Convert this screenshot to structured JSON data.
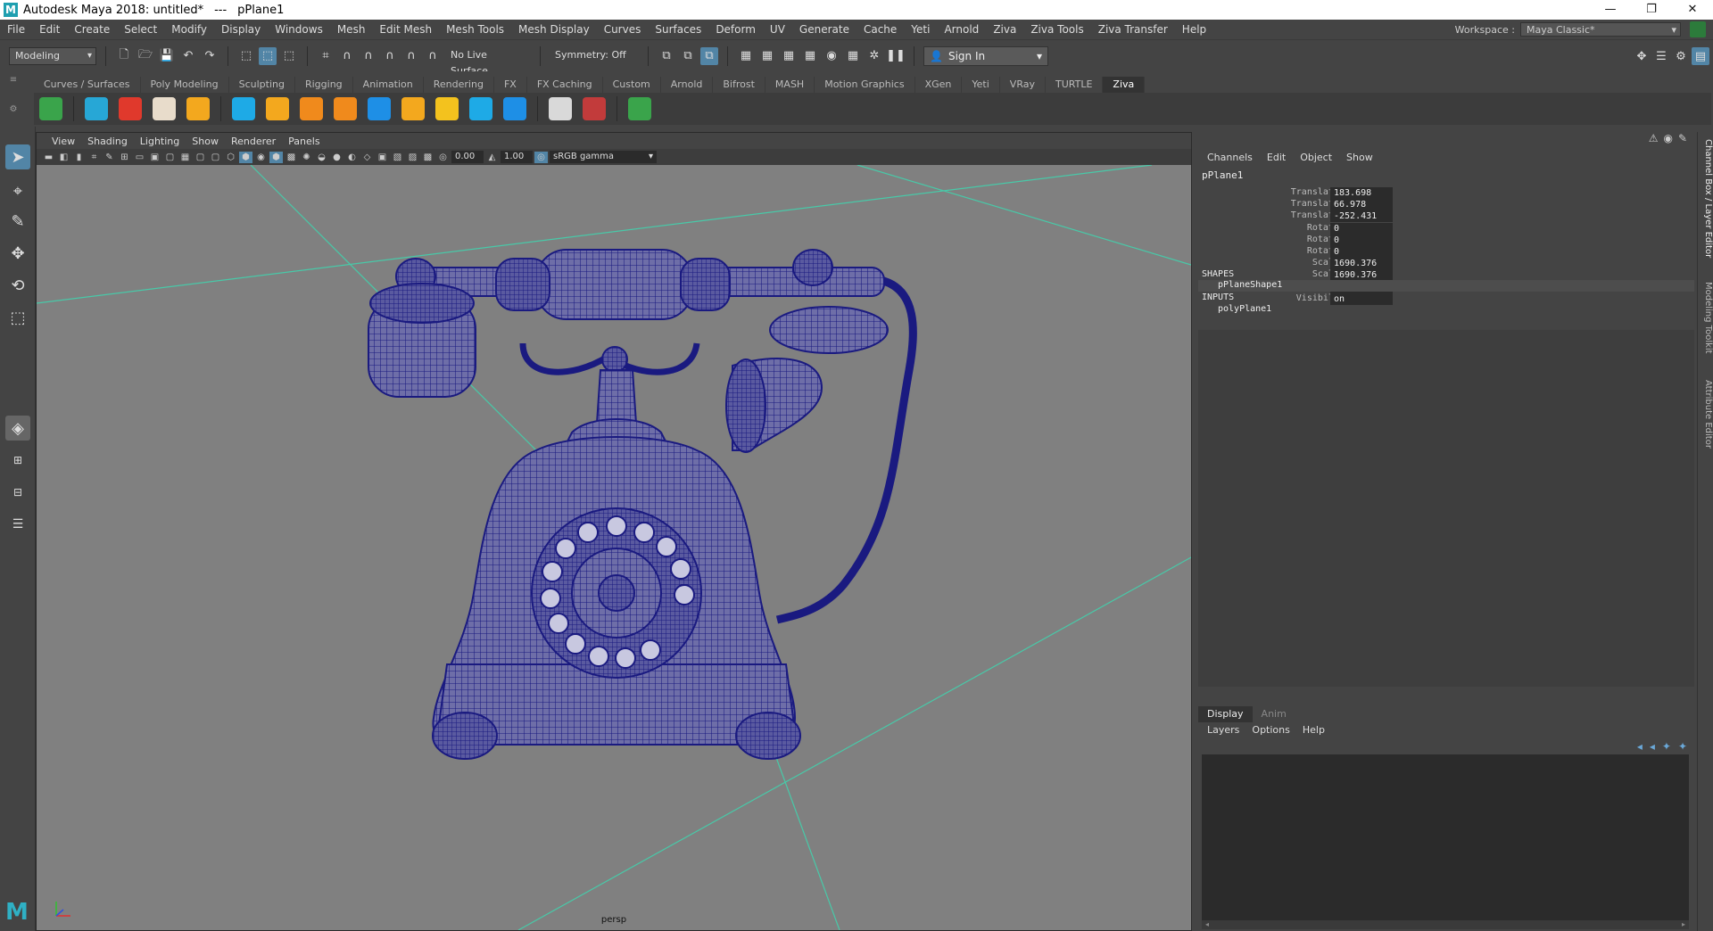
{
  "window": {
    "title": "Autodesk Maya 2018: untitled*",
    "separator": "---",
    "selection": "pPlane1",
    "controls": [
      "—",
      "❐",
      "✕"
    ]
  },
  "menus": [
    "File",
    "Edit",
    "Create",
    "Select",
    "Modify",
    "Display",
    "Windows",
    "Mesh",
    "Edit Mesh",
    "Mesh Tools",
    "Mesh Display",
    "Curves",
    "Surfaces",
    "Deform",
    "UV",
    "Generate",
    "Cache",
    "Yeti",
    "Arnold",
    "Ziva",
    "Ziva Tools",
    "Ziva Transfer",
    "Help"
  ],
  "workspace": {
    "label": "Workspace :",
    "value": "Maya Classic*"
  },
  "statusline": {
    "mode": "Modeling",
    "live_surface": "No Live Surface",
    "symmetry": "Symmetry: Off",
    "signin": "Sign In"
  },
  "shelf_tabs": [
    "Curves / Surfaces",
    "Poly Modeling",
    "Sculpting",
    "Rigging",
    "Animation",
    "Rendering",
    "FX",
    "FX Caching",
    "Custom",
    "Arnold",
    "Bifrost",
    "MASH",
    "Motion Graphics",
    "XGen",
    "Yeti",
    "VRay",
    "TURTLE",
    "Ziva"
  ],
  "shelf_active": "Ziva",
  "shelf_icons": [
    {
      "name": "ziva-load-icon",
      "color": "#3aa44b"
    },
    {
      "name": "ziva-tissue-icon",
      "color": "#27a7d6"
    },
    {
      "name": "ziva-muscle-icon",
      "color": "#e0392c"
    },
    {
      "name": "ziva-bone-icon",
      "color": "#e8dccb"
    },
    {
      "name": "ziva-star-icon",
      "color": "#f3a81e"
    },
    {
      "name": "ziva-attachment-icon",
      "color": "#1eaae6"
    },
    {
      "name": "ziva-cloth-icon",
      "color": "#f3a81e"
    },
    {
      "name": "ziva-fiber-icon",
      "color": "#f08a1c"
    },
    {
      "name": "ziva-material-icon",
      "color": "#f08a1c"
    },
    {
      "name": "ziva-line-of-action-icon",
      "color": "#1e8fe6"
    },
    {
      "name": "ziva-rivet-icon",
      "color": "#f3a81e"
    },
    {
      "name": "ziva-curve-icon",
      "color": "#f3c21e"
    },
    {
      "name": "ziva-paint-icon",
      "color": "#1eaae6"
    },
    {
      "name": "ziva-cache-icon",
      "color": "#1e8fe6"
    },
    {
      "name": "ziva-settings-icon",
      "color": "#d9d9d9"
    },
    {
      "name": "ziva-delete-icon",
      "color": "#c23b3b"
    },
    {
      "name": "ziva-play-icon",
      "color": "#3aa44b"
    }
  ],
  "viewport": {
    "menus": [
      "View",
      "Shading",
      "Lighting",
      "Show",
      "Renderer",
      "Panels"
    ],
    "exposure": "0.00",
    "gamma": "1.00",
    "colorspace": "sRGB gamma",
    "camera": "persp"
  },
  "channel_box": {
    "menus": [
      "Channels",
      "Edit",
      "Object",
      "Show"
    ],
    "object": "pPlane1",
    "attributes": [
      {
        "label": "Translate X",
        "value": "183.698"
      },
      {
        "label": "Translate Y",
        "value": "66.978"
      },
      {
        "label": "Translate Z",
        "value": "-252.431"
      },
      {
        "label": "Rotate X",
        "value": "0"
      },
      {
        "label": "Rotate Y",
        "value": "0"
      },
      {
        "label": "Rotate Z",
        "value": "0"
      },
      {
        "label": "Scale X",
        "value": "1690.376"
      },
      {
        "label": "Scale Y",
        "value": "1690.376"
      },
      {
        "label": "Scale Z",
        "value": "1690.376"
      },
      {
        "label": "Visibility",
        "value": "on"
      }
    ],
    "shapes_label": "SHAPES",
    "shape": "pPlaneShape1",
    "inputs_label": "INPUTS",
    "input": "polyPlane1"
  },
  "layer_editor": {
    "tabs": [
      "Display",
      "Anim"
    ],
    "menus": [
      "Layers",
      "Options",
      "Help"
    ]
  },
  "side_tabs": [
    "Channel Box / Layer Editor",
    "Modeling Toolkit",
    "Attribute Editor"
  ],
  "colors": {
    "wireframe": "#1a1a80",
    "grid": "#48c9a8",
    "background": "#808080",
    "highlight": "#5285a6"
  }
}
